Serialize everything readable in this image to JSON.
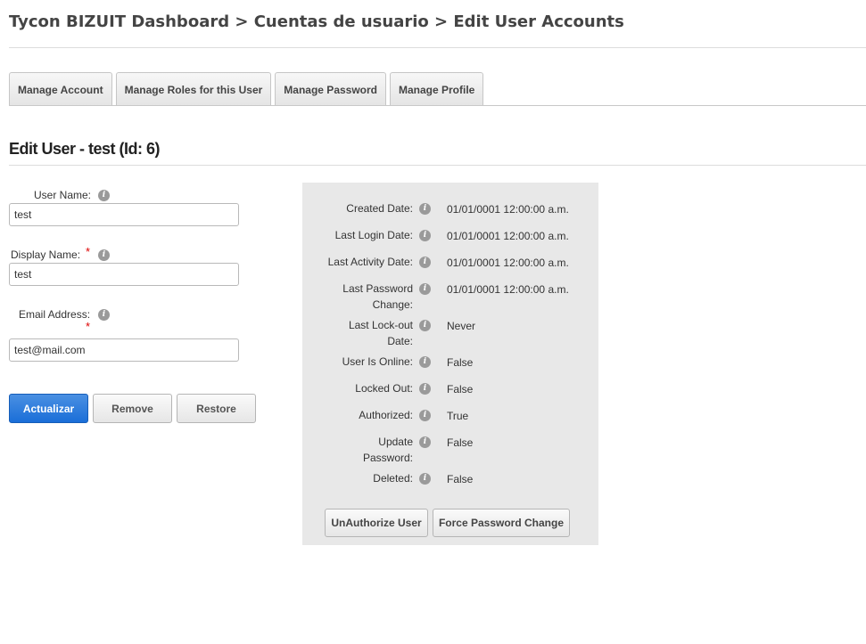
{
  "breadcrumb": "Tycon BIZUIT Dashboard > Cuentas de usuario > Edit User Accounts",
  "tabs": [
    {
      "label": "Manage Account"
    },
    {
      "label": "Manage Roles for this User"
    },
    {
      "label": "Manage Password"
    },
    {
      "label": "Manage Profile"
    }
  ],
  "section_title": "Edit User - test (Id: 6)",
  "form": {
    "username_label": "User Name:",
    "username_value": "test",
    "displayname_label": "Display Name:",
    "displayname_value": "test",
    "email_label": "Email Address:",
    "email_value": "test@mail.com",
    "required_marker": "*"
  },
  "buttons": {
    "update": "Actualizar",
    "remove": "Remove",
    "restore": "Restore"
  },
  "info_icon_glyph": "i",
  "details": [
    {
      "label": "Created Date:",
      "value": "01/01/0001 12:00:00 a.m."
    },
    {
      "label": "Last Login Date:",
      "value": "01/01/0001 12:00:00 a.m."
    },
    {
      "label": "Last Activity Date:",
      "value": "01/01/0001 12:00:00 a.m."
    },
    {
      "label_line1": "Last Password",
      "label_line2": "Change:",
      "value": "01/01/0001 12:00:00 a.m."
    },
    {
      "label_line1": "Last Lock-out",
      "label_line2": "Date:",
      "value": "Never"
    },
    {
      "label": "User Is Online:",
      "value": "False"
    },
    {
      "label": "Locked Out:",
      "value": "False"
    },
    {
      "label": "Authorized:",
      "value": "True"
    },
    {
      "label_line1": "Update",
      "label_line2": "Password:",
      "value": "False"
    },
    {
      "label": "Deleted:",
      "value": "False"
    }
  ],
  "panel_buttons": {
    "unauthorize": "UnAuthorize User",
    "force_password": "Force Password Change"
  },
  "colors": {
    "primary": "#1a6ed8",
    "required": "#dd0000",
    "panel_bg": "#e8e8e8",
    "info_icon": "#9a9a9a"
  }
}
